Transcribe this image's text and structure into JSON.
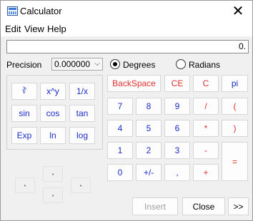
{
  "window": {
    "title": "Calculator",
    "close_glyph": "✕",
    "app_icon": "calculator-icon"
  },
  "menu": [
    "Edit",
    "View",
    "Help"
  ],
  "display": {
    "value": "0."
  },
  "precision": {
    "label": "Precision",
    "value": "0.000000",
    "chevron": "⌵"
  },
  "angle_mode": {
    "options": [
      {
        "label": "Degrees",
        "checked": true
      },
      {
        "label": "Radians",
        "checked": false
      }
    ]
  },
  "scientific": {
    "row1": [
      "∛",
      "x^y",
      "1/x"
    ],
    "row2": [
      "sin",
      "cos",
      "tan"
    ],
    "row3": [
      "Exp",
      "ln",
      "log"
    ]
  },
  "keypad": {
    "backspace": "BackSpace",
    "ce": "CE",
    "c": "C",
    "pi": "pi",
    "rows": [
      [
        "7",
        "8",
        "9",
        "/",
        "("
      ],
      [
        "4",
        "5",
        "6",
        "*",
        ")"
      ],
      [
        "1",
        "2",
        "3",
        "-"
      ],
      [
        "0",
        "+/-",
        ",",
        "+"
      ]
    ],
    "equals": "="
  },
  "nav_dots": {
    "up": "•",
    "left": "•",
    "right": "•",
    "down": "•",
    "center": "•"
  },
  "bottom": {
    "insert": "Insert",
    "close": "Close",
    "expand": ">>"
  },
  "colors": {
    "blue_key": "#1a2cc8",
    "red_key": "#e03030",
    "button_bg": "#fdfdfd",
    "window_bg": "#f0f0f0"
  }
}
